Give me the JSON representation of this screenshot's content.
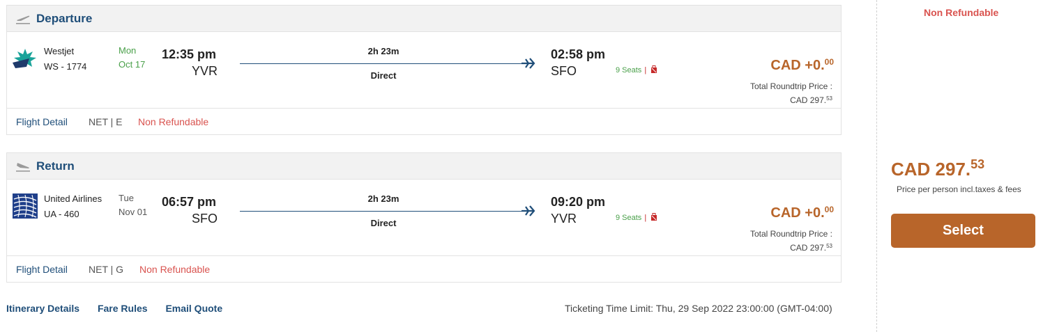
{
  "departure": {
    "title": "Departure",
    "airline": "Westjet",
    "flight_no": "WS - 1774",
    "day": "Mon",
    "date": "Oct 17",
    "dep_time": "12:35 pm",
    "dep_code": "YVR",
    "duration": "2h 23m",
    "stops": "Direct",
    "arr_time": "02:58 pm",
    "arr_code": "SFO",
    "seats": "9 Seats",
    "price_add_main": "CAD +0.",
    "price_add_cents": "00",
    "total_label": "Total Roundtrip Price :",
    "total_main": "CAD 297.",
    "total_cents": "53",
    "flight_detail": "Flight Detail",
    "fare_class": "NET | E",
    "refund": "Non Refundable"
  },
  "return": {
    "title": "Return",
    "airline": "United Airlines",
    "flight_no": "UA - 460",
    "day": "Tue",
    "date": "Nov 01",
    "dep_time": "06:57 pm",
    "dep_code": "SFO",
    "duration": "2h 23m",
    "stops": "Direct",
    "arr_time": "09:20 pm",
    "arr_code": "YVR",
    "seats": "9 Seats",
    "price_add_main": "CAD +0.",
    "price_add_cents": "00",
    "total_label": "Total Roundtrip Price :",
    "total_main": "CAD 297.",
    "total_cents": "53",
    "flight_detail": "Flight Detail",
    "fare_class": "NET | G",
    "refund": "Non Refundable"
  },
  "links": {
    "itinerary": "Itinerary Details",
    "fare_rules": "Fare Rules",
    "email_quote": "Email Quote"
  },
  "ticket_limit": "Ticketing Time Limit: Thu, 29 Sep 2022 23:00:00 (GMT-04:00)",
  "sidebar": {
    "refund": "Non Refundable",
    "price_main": "CAD 297.",
    "price_cents": "53",
    "price_note": "Price per person incl.taxes & fees",
    "select_label": "Select"
  },
  "colors": {
    "brand_blue": "#1f4e79",
    "price_orange": "#b8652a",
    "refund_red": "#d9534f",
    "date_green": "#4aa04a"
  }
}
